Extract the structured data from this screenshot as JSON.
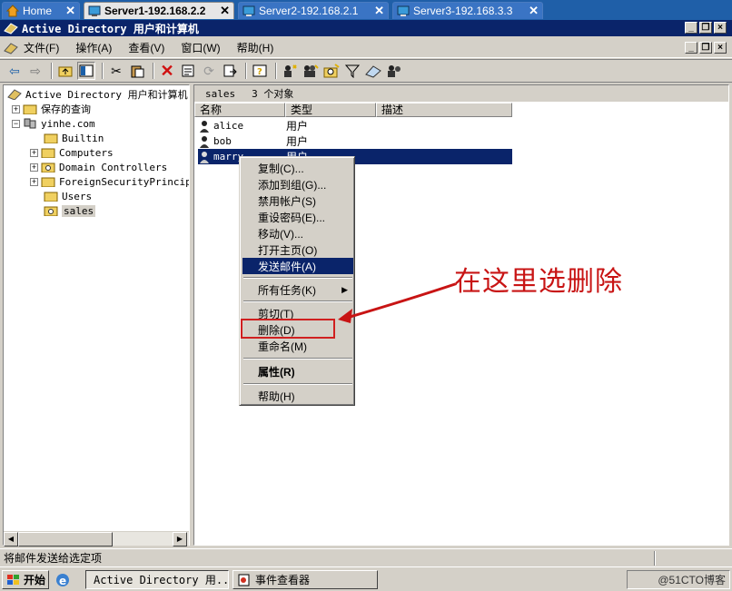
{
  "tabs": [
    {
      "label": "Home",
      "color": "#f0a020",
      "active": false
    },
    {
      "label": "Server1-192.168.2.2",
      "active": true
    },
    {
      "label": "Server2-192.168.2.1",
      "active": false
    },
    {
      "label": "Server3-192.168.3.3",
      "active": false
    }
  ],
  "window": {
    "title": "Active Directory 用户和计算机",
    "title_bg": "#0a246a"
  },
  "menu": [
    "文件(F)",
    "操作(A)",
    "查看(V)",
    "窗口(W)",
    "帮助(H)"
  ],
  "toolbar_icons": [
    "back-icon",
    "forward-icon",
    "up-folder-icon",
    "show-tree-icon",
    "cut-icon",
    "paste-icon",
    "delete-icon",
    "properties-icon",
    "refresh-icon",
    "export-icon",
    "help-icon",
    "new-user-icon",
    "new-group-icon",
    "new-ou-icon",
    "filter-icon",
    "find-icon",
    "add-to-group-icon"
  ],
  "tree": {
    "root": "Active Directory 用户和计算机",
    "saved_queries": "保存的查询",
    "domain": "yinhe.com",
    "children": [
      "Builtin",
      "Computers",
      "Domain Controllers",
      "ForeignSecurityPrincipa",
      "Users",
      "sales"
    ],
    "selected": "sales"
  },
  "list": {
    "header_title": "sales",
    "header_count": "3 个对象",
    "columns": [
      "名称",
      "类型",
      "描述"
    ],
    "rows": [
      {
        "name": "alice",
        "type": "用户"
      },
      {
        "name": "bob",
        "type": "用户"
      },
      {
        "name": "marry",
        "type": "用户"
      }
    ],
    "selected_color": "#0a246a"
  },
  "context_menu": {
    "copy": "复制(C)...",
    "add_to_group": "添加到组(G)...",
    "disable": "禁用帐户(S)",
    "reset_pw": "重设密码(E)...",
    "move": "移动(V)...",
    "open_home": "打开主页(O)",
    "send_mail": "发送邮件(A)",
    "all_tasks": "所有任务(K)",
    "cut": "剪切(T)",
    "delete": "删除(D)",
    "rename": "重命名(M)",
    "properties": "属性(R)",
    "help": "帮助(H)"
  },
  "annotation": {
    "text": "在这里选删除",
    "color": "#c81414"
  },
  "status": "将邮件发送给选定项",
  "taskbar": {
    "start": "开始",
    "buttons": [
      "Active Directory 用...",
      "事件查看器"
    ],
    "watermark": "@51CTO博客"
  }
}
